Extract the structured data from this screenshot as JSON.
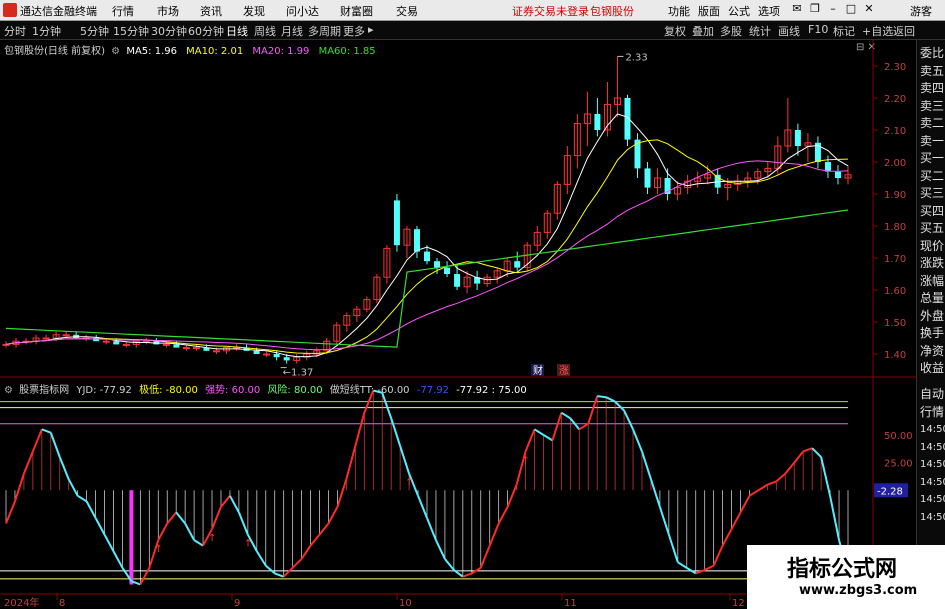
{
  "app": {
    "title": "通达信金融终端",
    "menu": [
      "行情",
      "市场",
      "资讯",
      "发现",
      "问小达",
      "财富圈",
      "交易"
    ],
    "warning": "证券交易未登录",
    "stock_tag": "包钢股份",
    "right_menu": [
      "功能",
      "版面",
      "公式",
      "选项"
    ],
    "guest": "游客"
  },
  "toolbar": {
    "periods": [
      "分时",
      "1分钟",
      "5分钟",
      "15分钟",
      "30分钟",
      "60分钟",
      "日线",
      "周线",
      "月线",
      "多周期",
      "更多"
    ],
    "active": "日线",
    "right_buttons": [
      "复权",
      "叠加",
      "多股",
      "统计",
      "画线",
      "F10",
      "标记",
      "+自选",
      "返回"
    ]
  },
  "main_chart": {
    "title": "包钢股份(日线 前复权)",
    "ma": [
      {
        "label": "MA5: 1.96",
        "color": "#ffffff"
      },
      {
        "label": "MA10: 2.01",
        "color": "#ffff00"
      },
      {
        "label": "MA20: 1.99",
        "color": "#ff55ff"
      },
      {
        "label": "MA60: 1.85",
        "color": "#33dd33"
      }
    ],
    "high_label": "2.33",
    "low_label": "1.37",
    "cai": "财",
    "zhang": "涨",
    "yticks": [
      "2.30",
      "2.20",
      "2.10",
      "2.00",
      "1.90",
      "1.80",
      "1.70",
      "1.60",
      "1.50",
      "1.40"
    ]
  },
  "indicator": {
    "name": "股票指标网",
    "items": [
      {
        "label": "YJD: -77.92",
        "color": "#d0d0d0"
      },
      {
        "label": "极低: -80.00",
        "color": "#ffff00"
      },
      {
        "label": "强势: 60.00",
        "color": "#ff55ff"
      },
      {
        "label": "风险: 80.00",
        "color": "#66ff66"
      },
      {
        "label": "做短线TT: -60.00",
        "color": "#d0d0d0"
      },
      {
        "label": "-77.92",
        "color": "#3355ff"
      },
      {
        "label": "-77.92 : 75.00",
        "color": "#ffffff"
      }
    ],
    "yticks": [
      "50.00",
      "25.00"
    ],
    "current": "-2.28"
  },
  "xaxis": {
    "year": "2024年",
    "months": [
      "8",
      "9",
      "10",
      "11",
      "12"
    ]
  },
  "sidebar": {
    "items": [
      "委比",
      "卖五",
      "卖四",
      "卖三",
      "卖二",
      "卖一",
      "买一",
      "买二",
      "买三",
      "买四",
      "买五",
      "现价",
      "涨跌",
      "涨幅",
      "总量",
      "外盘",
      "换手",
      "净资",
      "收益"
    ],
    "items2": [
      "自动",
      "行情"
    ],
    "times": [
      "14:50",
      "14:50",
      "14:50",
      "14:50",
      "14:50",
      "14:50"
    ]
  },
  "watermark": {
    "name": "指标公式网",
    "url": "www.zbgs3.com"
  },
  "chart_data": {
    "type": "candlestick",
    "title": "包钢股份(日线 前复权)",
    "price_range": [
      1.35,
      2.35
    ],
    "ohlc": [
      [
        1.43,
        1.44,
        1.42,
        1.43
      ],
      [
        1.43,
        1.45,
        1.42,
        1.44
      ],
      [
        1.44,
        1.45,
        1.43,
        1.44
      ],
      [
        1.44,
        1.46,
        1.43,
        1.45
      ],
      [
        1.45,
        1.46,
        1.44,
        1.45
      ],
      [
        1.45,
        1.47,
        1.44,
        1.46
      ],
      [
        1.46,
        1.47,
        1.45,
        1.46
      ],
      [
        1.46,
        1.47,
        1.45,
        1.45
      ],
      [
        1.45,
        1.46,
        1.44,
        1.45
      ],
      [
        1.45,
        1.46,
        1.44,
        1.44
      ],
      [
        1.44,
        1.45,
        1.43,
        1.44
      ],
      [
        1.44,
        1.45,
        1.43,
        1.43
      ],
      [
        1.43,
        1.44,
        1.42,
        1.43
      ],
      [
        1.43,
        1.44,
        1.42,
        1.44
      ],
      [
        1.44,
        1.45,
        1.43,
        1.44
      ],
      [
        1.44,
        1.45,
        1.43,
        1.43
      ],
      [
        1.43,
        1.44,
        1.42,
        1.43
      ],
      [
        1.43,
        1.44,
        1.42,
        1.42
      ],
      [
        1.42,
        1.43,
        1.41,
        1.42
      ],
      [
        1.42,
        1.43,
        1.41,
        1.42
      ],
      [
        1.42,
        1.43,
        1.41,
        1.41
      ],
      [
        1.41,
        1.42,
        1.4,
        1.41
      ],
      [
        1.41,
        1.42,
        1.4,
        1.42
      ],
      [
        1.42,
        1.43,
        1.41,
        1.42
      ],
      [
        1.42,
        1.43,
        1.41,
        1.41
      ],
      [
        1.41,
        1.42,
        1.4,
        1.4
      ],
      [
        1.4,
        1.41,
        1.39,
        1.4
      ],
      [
        1.4,
        1.41,
        1.38,
        1.39
      ],
      [
        1.39,
        1.4,
        1.37,
        1.38
      ],
      [
        1.38,
        1.4,
        1.37,
        1.39
      ],
      [
        1.39,
        1.41,
        1.38,
        1.4
      ],
      [
        1.4,
        1.42,
        1.39,
        1.41
      ],
      [
        1.41,
        1.45,
        1.4,
        1.44
      ],
      [
        1.44,
        1.5,
        1.43,
        1.49
      ],
      [
        1.49,
        1.53,
        1.47,
        1.52
      ],
      [
        1.52,
        1.55,
        1.5,
        1.54
      ],
      [
        1.54,
        1.58,
        1.53,
        1.57
      ],
      [
        1.57,
        1.65,
        1.56,
        1.64
      ],
      [
        1.64,
        1.74,
        1.62,
        1.73
      ],
      [
        1.88,
        1.9,
        1.72,
        1.74
      ],
      [
        1.74,
        1.8,
        1.7,
        1.79
      ],
      [
        1.79,
        1.8,
        1.7,
        1.72
      ],
      [
        1.72,
        1.74,
        1.68,
        1.69
      ],
      [
        1.69,
        1.7,
        1.65,
        1.67
      ],
      [
        1.67,
        1.69,
        1.64,
        1.65
      ],
      [
        1.65,
        1.68,
        1.6,
        1.61
      ],
      [
        1.61,
        1.66,
        1.59,
        1.64
      ],
      [
        1.64,
        1.66,
        1.6,
        1.62
      ],
      [
        1.62,
        1.65,
        1.61,
        1.64
      ],
      [
        1.64,
        1.67,
        1.62,
        1.66
      ],
      [
        1.66,
        1.7,
        1.64,
        1.69
      ],
      [
        1.69,
        1.72,
        1.66,
        1.67
      ],
      [
        1.67,
        1.75,
        1.66,
        1.74
      ],
      [
        1.74,
        1.8,
        1.72,
        1.78
      ],
      [
        1.78,
        1.85,
        1.76,
        1.84
      ],
      [
        1.84,
        1.94,
        1.82,
        1.93
      ],
      [
        1.93,
        2.05,
        1.9,
        2.02
      ],
      [
        2.02,
        2.15,
        1.98,
        2.12
      ],
      [
        2.12,
        2.22,
        2.05,
        2.15
      ],
      [
        2.15,
        2.2,
        2.08,
        2.1
      ],
      [
        2.1,
        2.25,
        2.08,
        2.18
      ],
      [
        2.18,
        2.33,
        2.14,
        2.2
      ],
      [
        2.2,
        2.21,
        2.05,
        2.07
      ],
      [
        2.07,
        2.09,
        1.95,
        1.98
      ],
      [
        1.98,
        2.0,
        1.9,
        1.92
      ],
      [
        1.92,
        1.98,
        1.9,
        1.95
      ],
      [
        1.95,
        1.98,
        1.88,
        1.9
      ],
      [
        1.9,
        1.94,
        1.88,
        1.92
      ],
      [
        1.92,
        1.96,
        1.9,
        1.94
      ],
      [
        1.94,
        1.97,
        1.92,
        1.95
      ],
      [
        1.95,
        1.99,
        1.93,
        1.96
      ],
      [
        1.96,
        1.98,
        1.9,
        1.92
      ],
      [
        1.92,
        1.95,
        1.88,
        1.93
      ],
      [
        1.93,
        1.96,
        1.91,
        1.94
      ],
      [
        1.94,
        1.97,
        1.92,
        1.95
      ],
      [
        1.95,
        1.98,
        1.93,
        1.97
      ],
      [
        1.97,
        2.0,
        1.95,
        1.98
      ],
      [
        1.98,
        2.08,
        1.96,
        2.05
      ],
      [
        2.05,
        2.2,
        2.03,
        2.1
      ],
      [
        2.1,
        2.12,
        2.02,
        2.05
      ],
      [
        2.05,
        2.09,
        2.0,
        2.06
      ],
      [
        2.06,
        2.08,
        1.98,
        2.0
      ],
      [
        2.0,
        2.02,
        1.95,
        1.97
      ],
      [
        1.97,
        1.99,
        1.93,
        1.95
      ],
      [
        1.95,
        1.99,
        1.93,
        1.96
      ]
    ],
    "ma5_last": 1.96,
    "ma10_last": 2.01,
    "ma20_last": 1.99,
    "ma60_last": 1.85,
    "indicator_range": [
      -90,
      95
    ],
    "indicator": [
      -30,
      -10,
      15,
      35,
      55,
      52,
      30,
      10,
      -5,
      -10,
      -25,
      -40,
      -55,
      -70,
      -82,
      -85,
      -70,
      -45,
      -30,
      -20,
      -30,
      -45,
      -50,
      -35,
      -15,
      -5,
      -20,
      -40,
      -55,
      -68,
      -75,
      -78,
      -70,
      -62,
      -50,
      -40,
      -30,
      -15,
      10,
      40,
      70,
      90,
      88,
      65,
      40,
      15,
      -5,
      -25,
      -45,
      -62,
      -72,
      -78,
      -75,
      -70,
      -50,
      -30,
      -15,
      5,
      35,
      55,
      50,
      45,
      70,
      65,
      55,
      60,
      85,
      84,
      80,
      72,
      55,
      35,
      10,
      -15,
      -40,
      -65,
      -70,
      -75,
      -72,
      -68,
      -50,
      -35,
      -20,
      -5,
      0,
      5,
      8,
      15,
      25,
      35,
      38,
      30,
      -5,
      -45,
      -75
    ],
    "lines": {
      "risk": 80,
      "strong": 60,
      "low": -80
    }
  }
}
